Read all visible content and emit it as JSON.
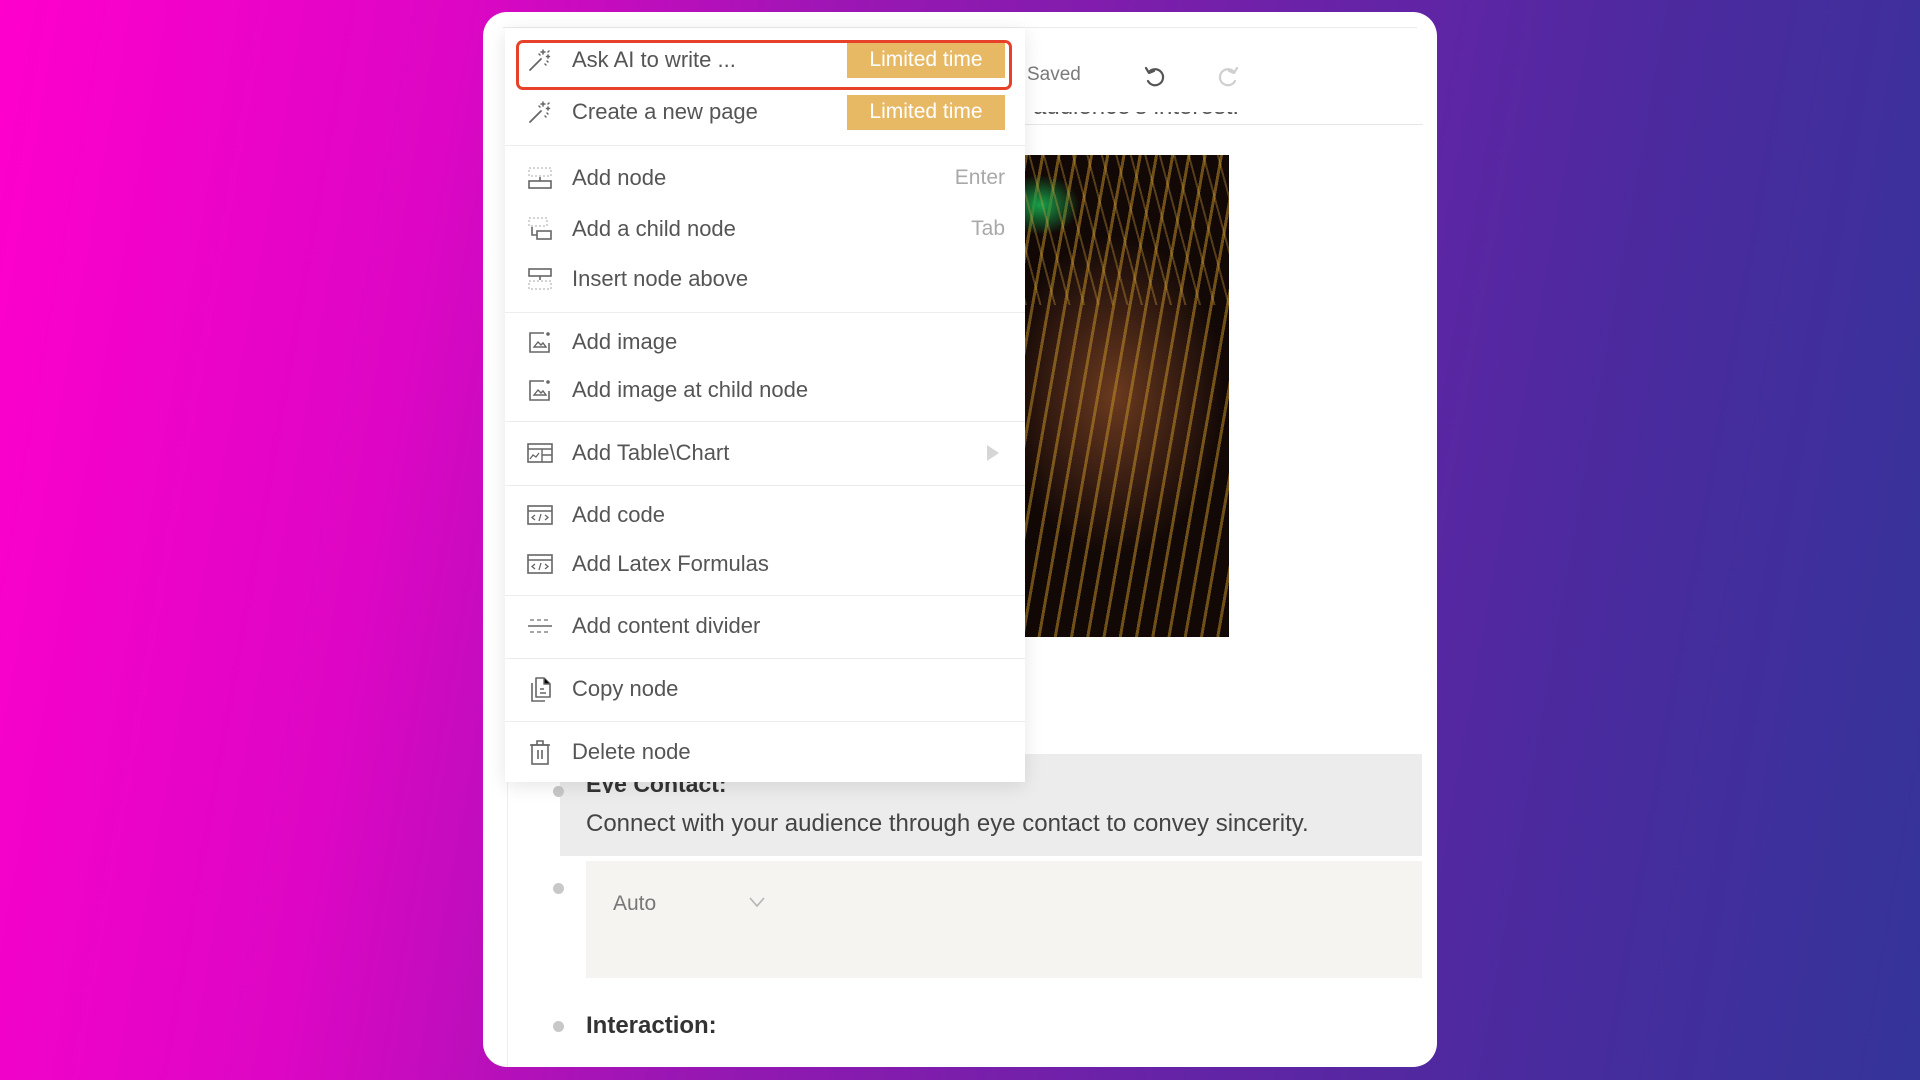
{
  "toolbar": {
    "status_text": "Saved",
    "undo_icon": "undo-icon",
    "redo_icon": "redo-icon"
  },
  "document": {
    "partial_text_above": "e audience's interest.",
    "image_alt": "photo-of-hanging-bags",
    "nodes": [
      {
        "title": "Eye Contact:",
        "body": "Connect with your audience through eye contact to convey sincerity."
      },
      {
        "select_value": "Auto"
      },
      {
        "title": "Interaction:"
      }
    ]
  },
  "context_menu": {
    "highlighted_item": "Ask AI to write ...",
    "highlight_color": "#e8412a",
    "badge_color": "#e8b965",
    "items": [
      {
        "label": "Ask AI to write ...",
        "icon": "magic-wand-icon",
        "badge": "Limited time"
      },
      {
        "label": "Create a new page",
        "icon": "magic-wand-icon",
        "badge": "Limited time"
      },
      {
        "label": "Add node",
        "icon": "add-node-icon",
        "shortcut": "Enter"
      },
      {
        "label": "Add a child node",
        "icon": "add-child-node-icon",
        "shortcut": "Tab"
      },
      {
        "label": "Insert node above",
        "icon": "insert-above-icon"
      },
      {
        "label": "Add image",
        "icon": "add-image-icon"
      },
      {
        "label": "Add image at child node",
        "icon": "add-image-icon"
      },
      {
        "label": "Add Table\\Chart",
        "icon": "table-chart-icon",
        "submenu": true
      },
      {
        "label": "Add code",
        "icon": "code-icon"
      },
      {
        "label": "Add Latex Formulas",
        "icon": "code-icon"
      },
      {
        "label": "Add content divider",
        "icon": "divider-icon"
      },
      {
        "label": "Copy node",
        "icon": "copy-icon"
      },
      {
        "label": "Delete node",
        "icon": "trash-icon"
      }
    ]
  }
}
